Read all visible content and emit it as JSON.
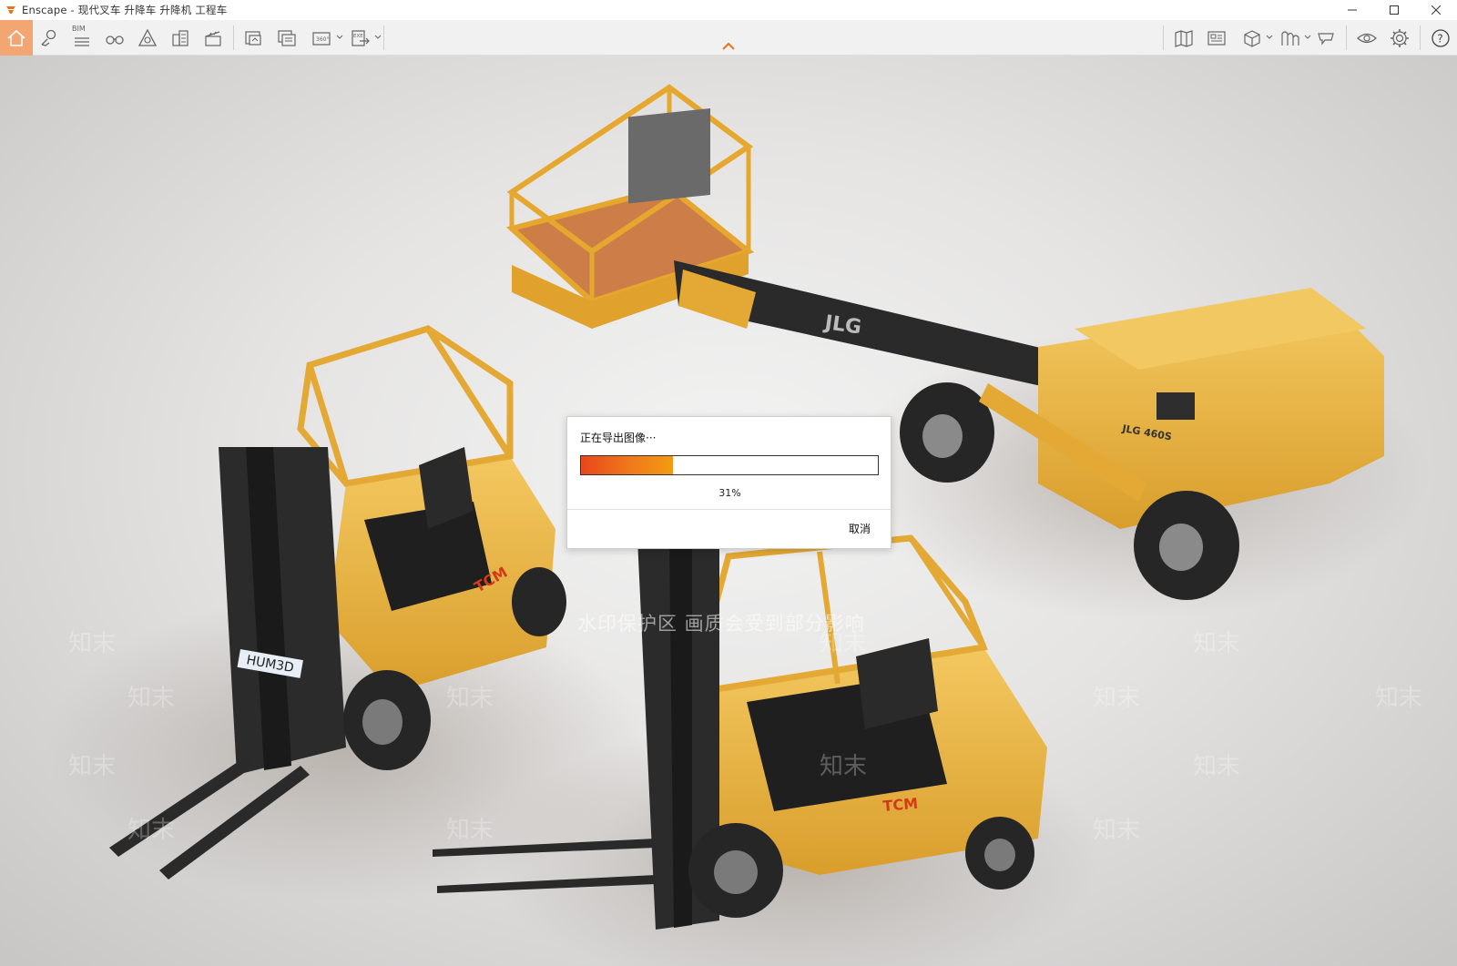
{
  "window": {
    "title": "Enscape - 现代叉车 升降车 升降机 工程车"
  },
  "colors": {
    "accent": "#f4a672",
    "logo": "#e8731a",
    "progress_start": "#e8471c",
    "progress_end": "#f29a12",
    "machine_yellow": "#e8b542"
  },
  "toolbar": {
    "bim_label": "BIM",
    "left_icons": [
      "home-icon",
      "map-pin-icon",
      "bim-icon",
      "binoculars-icon",
      "atmosphere-icon",
      "buildings-icon",
      "clapperboard-icon"
    ],
    "export_icons": [
      "screenshot-icon",
      "batch-render-icon",
      "panorama-360-icon",
      "exe-export-icon"
    ],
    "right_icons": [
      "map-icon",
      "asset-library-icon",
      "material-cube-icon",
      "collaboration-icon",
      "feedback-icon",
      "visual-settings-icon",
      "settings-icon",
      "help-icon"
    ],
    "panorama_label": "360°",
    "exe_label": "EXE",
    "help_label": "?"
  },
  "scene": {
    "brand_boom": "JLG",
    "model_boom": "JLG 460S",
    "brand_forklift": "TCM",
    "plate_text": "HUM3D",
    "watermark_banner": "水印保护区  画质会受到部分影响",
    "watermark_text": "知末"
  },
  "dialog": {
    "title": "正在导出图像···",
    "progress_percent": 31,
    "progress_label": "31%",
    "cancel_label": "取消"
  }
}
